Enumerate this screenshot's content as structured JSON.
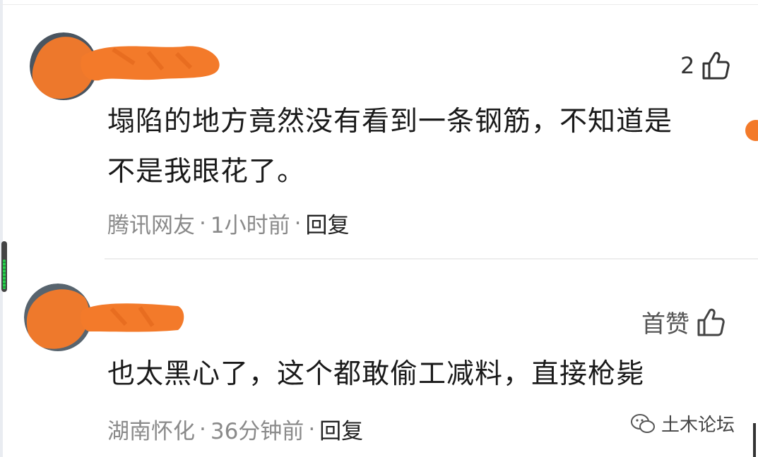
{
  "comments": [
    {
      "like_count": "2",
      "text_line1": "塌陷的地方竟然没有看到一条钢筋，不知道是",
      "text_line2": "不是我眼花了。",
      "author": "腾讯网友",
      "sep1": "·",
      "time": "1小时前",
      "sep2": "·",
      "reply": "回复",
      "like_icon": "thumbs-up-icon"
    },
    {
      "like_label": "首赞",
      "text_line1": "也太黑心了，这个都敢偷工减料，直接枪毙",
      "author": "湖南怀化",
      "sep1": "·",
      "time": "36分钟前",
      "sep2": "·",
      "reply": "回复",
      "like_icon": "thumbs-up-icon"
    }
  ],
  "watermark": {
    "icon": "wechat-icon",
    "text": "土木论坛"
  },
  "colors": {
    "redaction": "#f37a2a",
    "text": "#1a1a1a",
    "meta": "#8a8a8a"
  }
}
